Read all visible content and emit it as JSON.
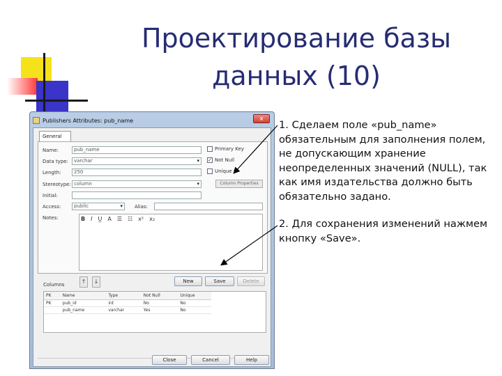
{
  "slide": {
    "title_line1": "Проектирование базы",
    "title_line2": "данных (10)"
  },
  "dialog": {
    "title": "Publishers Attributes: pub_name",
    "close_glyph": "x",
    "tab_general": "General",
    "fields": {
      "name_label": "Name:",
      "name_value": "pub_name",
      "datatype_label": "Data type:",
      "datatype_value": "varchar",
      "length_label": "Length:",
      "length_value": "250",
      "stereotype_label": "Stereotype:",
      "stereotype_value": "column",
      "initial_label": "Initial:",
      "access_label": "Access:",
      "access_value": "public",
      "alias_label": "Alias:",
      "notes_label": "Notes:"
    },
    "checkboxes": {
      "primary_key": "Primary Key",
      "primary_key_checked": false,
      "not_null": "Not Null",
      "not_null_checked": true,
      "unique": "Unique",
      "unique_checked": false
    },
    "column_properties_button": "Column Properties",
    "format_toolbar": [
      "B",
      "I",
      "U̲",
      "A",
      "☰",
      "☷",
      "x²",
      "x₂"
    ],
    "columns_label": "Columns",
    "buttons": {
      "new": "New",
      "save": "Save",
      "delete": "Delete",
      "close": "Close",
      "cancel": "Cancel",
      "help": "Help"
    },
    "grid": {
      "headers": [
        "PK",
        "Name",
        "Type",
        "Not Null",
        "Unique"
      ],
      "rows": [
        [
          "PK",
          "pub_id",
          "int",
          "No",
          "No"
        ],
        [
          "",
          "pub_name",
          "varchar",
          "Yes",
          "No"
        ]
      ]
    }
  },
  "annotations": {
    "note1": "1. Сделаем поле «pub_name» обязательным для заполнения полем, не допускающим хранение неопределенных значений (NULL), так как имя издательства должно быть обязательно задано.",
    "note2": "2. Для сохранения изменений нажмем кнопку «Save»."
  },
  "colors": {
    "title": "#262c73",
    "deco_yellow": "#f6e21a",
    "deco_red": "#ff3838",
    "deco_blue": "#3a34c8"
  }
}
